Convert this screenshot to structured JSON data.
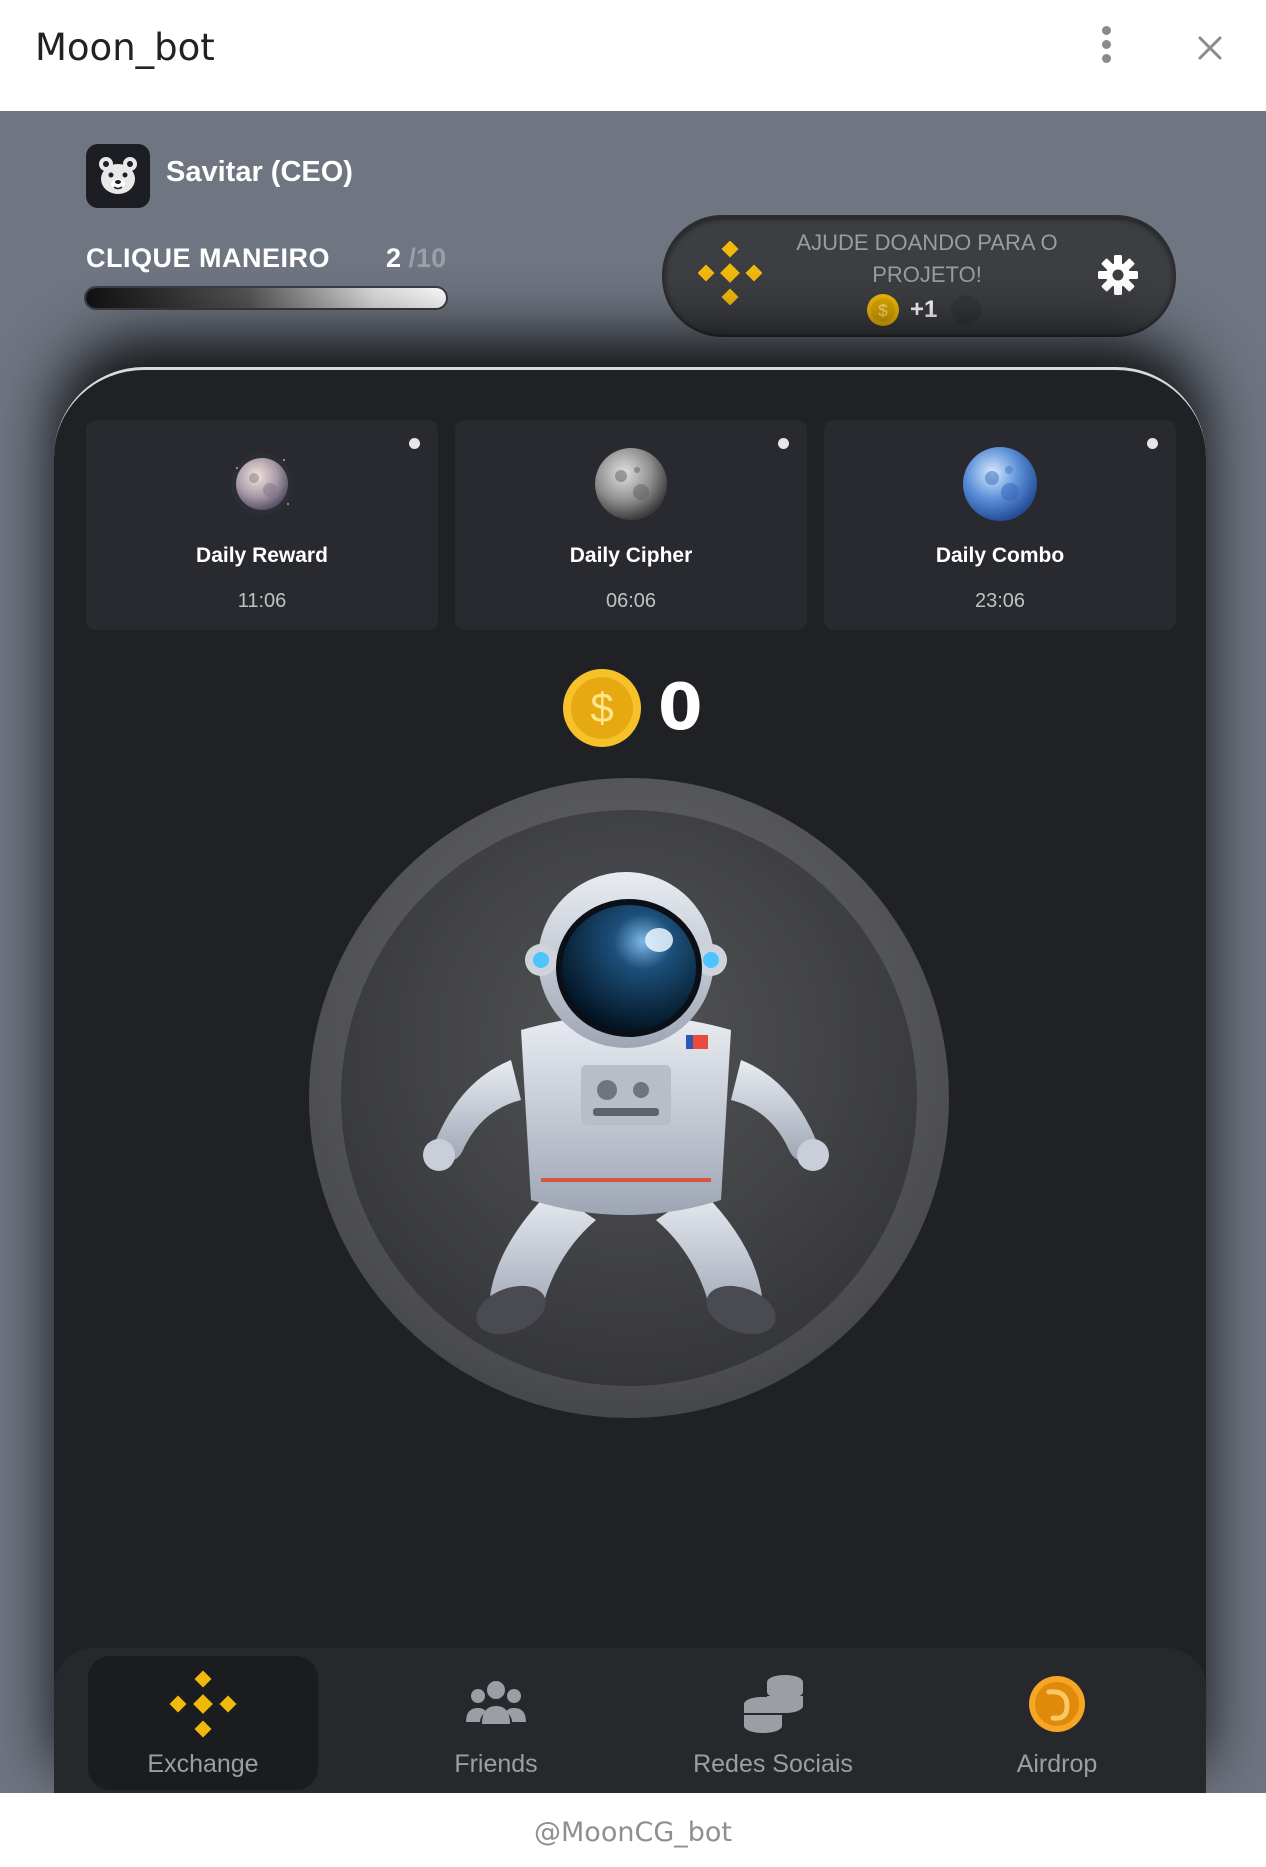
{
  "window": {
    "title": "Moon_bot"
  },
  "user": {
    "name": "Savitar (CEO)"
  },
  "level": {
    "name": "CLIQUE MANEIRO",
    "current": "2",
    "max": "/10",
    "progress": 0.95
  },
  "donate": {
    "text": "AJUDE DOANDO PARA O PROJETO!",
    "reward": "+1"
  },
  "daily": [
    {
      "name": "Daily Reward",
      "time": "11:06"
    },
    {
      "name": "Daily Cipher",
      "time": "06:06"
    },
    {
      "name": "Daily Combo",
      "time": "23:06"
    }
  ],
  "balance": {
    "value": "0"
  },
  "nav": [
    {
      "label": "Exchange",
      "active": true
    },
    {
      "label": "Friends",
      "active": false
    },
    {
      "label": "Redes Sociais",
      "active": false
    },
    {
      "label": "Airdrop",
      "active": false
    }
  ],
  "footer": {
    "handle": "@MoonCG_bot"
  },
  "colors": {
    "accent": "#f0b90b",
    "panel": "#1f2125",
    "background": "#6f7581"
  }
}
